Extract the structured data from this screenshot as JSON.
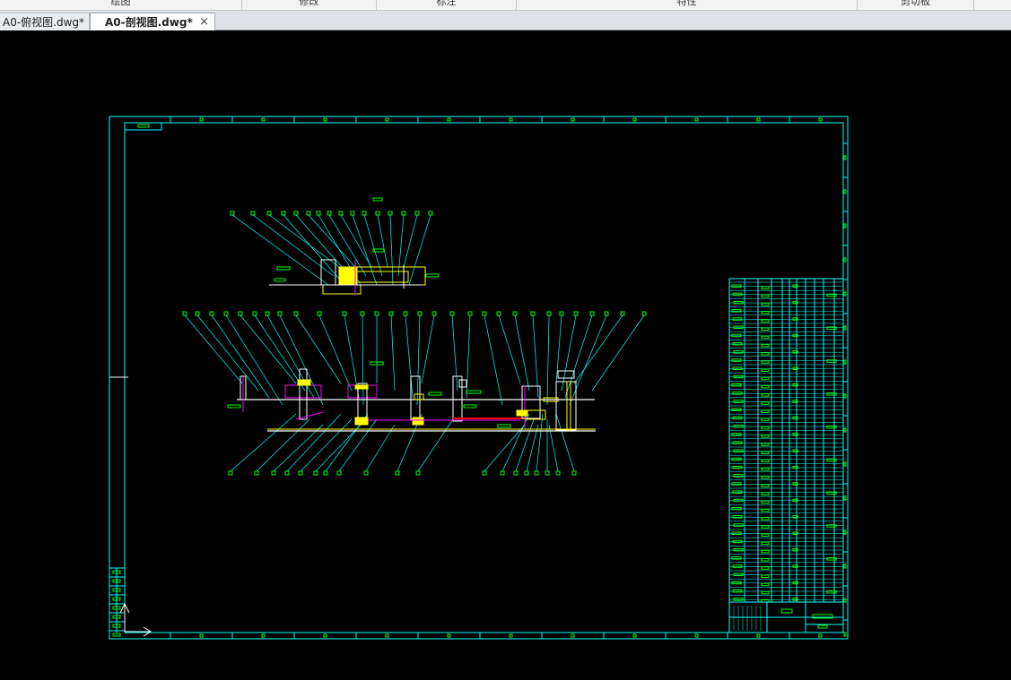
{
  "ribbon": {
    "groups": [
      "绘图",
      "修改",
      "标注",
      "特性",
      "剪切板"
    ]
  },
  "tabs": [
    {
      "label": "A0-俯视图.dwg*",
      "active": false
    },
    {
      "label": "A0-剖视图.dwg*",
      "active": true
    }
  ],
  "close_symbol": "×",
  "colors": {
    "background": "#000000",
    "frame": "#00ffff",
    "text_marks": "#00ff00",
    "parts": "#ffff00",
    "accent_red": "#ff0000",
    "accent_magenta": "#ff00ff",
    "white": "#ffffff"
  }
}
